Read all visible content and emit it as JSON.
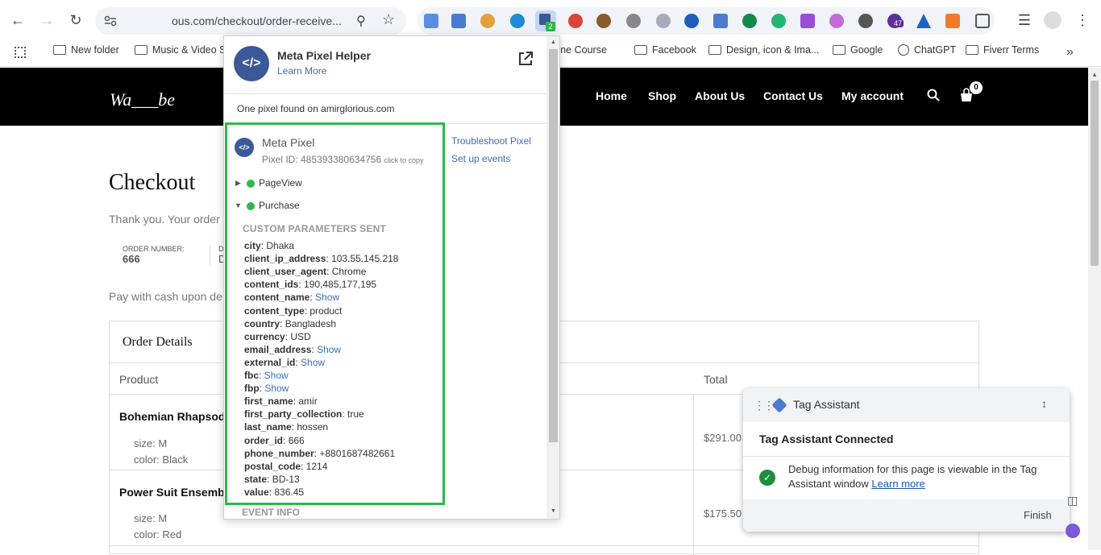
{
  "browser": {
    "url": "ous.com/checkout/order-receive...",
    "extension_badge": "2",
    "notification_count": "47",
    "bookmarks": [
      "New folder",
      "Music & Video S",
      "Online Course",
      "Facebook",
      "Design, icon & Ima...",
      "Google",
      "ChatGPT",
      "Fiverr Terms"
    ]
  },
  "site": {
    "logo": "Wa___be",
    "nav": [
      "Home",
      "Shop",
      "About Us",
      "Contact Us",
      "My account"
    ],
    "cart_count": "0"
  },
  "checkout": {
    "title": "Checkout",
    "thank_you": "Thank you. Your order",
    "order_number_label": "ORDER NUMBER:",
    "order_number": "666",
    "date_label_partial": "D",
    "date_value_partial": "D",
    "payment_note": "Pay with cash upon de",
    "order_details_title": "Order Details",
    "col_product": "Product",
    "col_total": "Total",
    "items": [
      {
        "name": "Bohemian Rhapsod",
        "size": "size: M",
        "color": "color: Black",
        "total": "$291.00"
      },
      {
        "name": "Power Suit Ensemb",
        "size": "size: M",
        "color": "color: Red",
        "total": "$175.50"
      }
    ]
  },
  "pixel_helper": {
    "title": "Meta Pixel Helper",
    "learn_more": "Learn More",
    "found_text": "One pixel found on amirglorious.com",
    "pixel_name": "Meta Pixel",
    "pixel_id_label": "Pixel ID: 485393380634756",
    "click_to_copy": "click to copy",
    "troubleshoot": "Troubleshoot Pixel",
    "setup_events": "Set up events",
    "events": [
      "PageView",
      "Purchase"
    ],
    "params_header": "CUSTOM PARAMETERS SENT",
    "params": [
      {
        "key": "city",
        "value": "Dhaka",
        "show": false
      },
      {
        "key": "client_ip_address",
        "value": "103.55.145.218",
        "show": false
      },
      {
        "key": "client_user_agent",
        "value": "Chrome",
        "show": false
      },
      {
        "key": "content_ids",
        "value": "190,485,177,195",
        "show": false
      },
      {
        "key": "content_name",
        "value": "Show",
        "show": true
      },
      {
        "key": "content_type",
        "value": "product",
        "show": false
      },
      {
        "key": "country",
        "value": "Bangladesh",
        "show": false
      },
      {
        "key": "currency",
        "value": "USD",
        "show": false
      },
      {
        "key": "email_address",
        "value": "Show",
        "show": true
      },
      {
        "key": "external_id",
        "value": "Show",
        "show": true
      },
      {
        "key": "fbc",
        "value": "Show",
        "show": true
      },
      {
        "key": "fbp",
        "value": "Show",
        "show": true
      },
      {
        "key": "first_name",
        "value": "amir",
        "show": false
      },
      {
        "key": "first_party_collection",
        "value": "true",
        "show": false
      },
      {
        "key": "last_name",
        "value": "hossen",
        "show": false
      },
      {
        "key": "order_id",
        "value": "666",
        "show": false
      },
      {
        "key": "phone_number",
        "value": "+8801687482661",
        "show": false
      },
      {
        "key": "postal_code",
        "value": "1214",
        "show": false
      },
      {
        "key": "state",
        "value": "BD-13",
        "show": false
      },
      {
        "key": "value",
        "value": "836.45",
        "show": false
      }
    ],
    "event_info": "EVENT INFO"
  },
  "tag_assistant": {
    "title": "Tag Assistant",
    "connected": "Tag Assistant Connected",
    "message": "Debug information for this page is viewable in the Tag Assistant window",
    "learn_more": "Learn more",
    "finish": "Finish"
  },
  "colors": {
    "accent_green": "#2fb94a",
    "link_blue": "#3b6fb6",
    "pixel_blue": "#3b5998"
  }
}
